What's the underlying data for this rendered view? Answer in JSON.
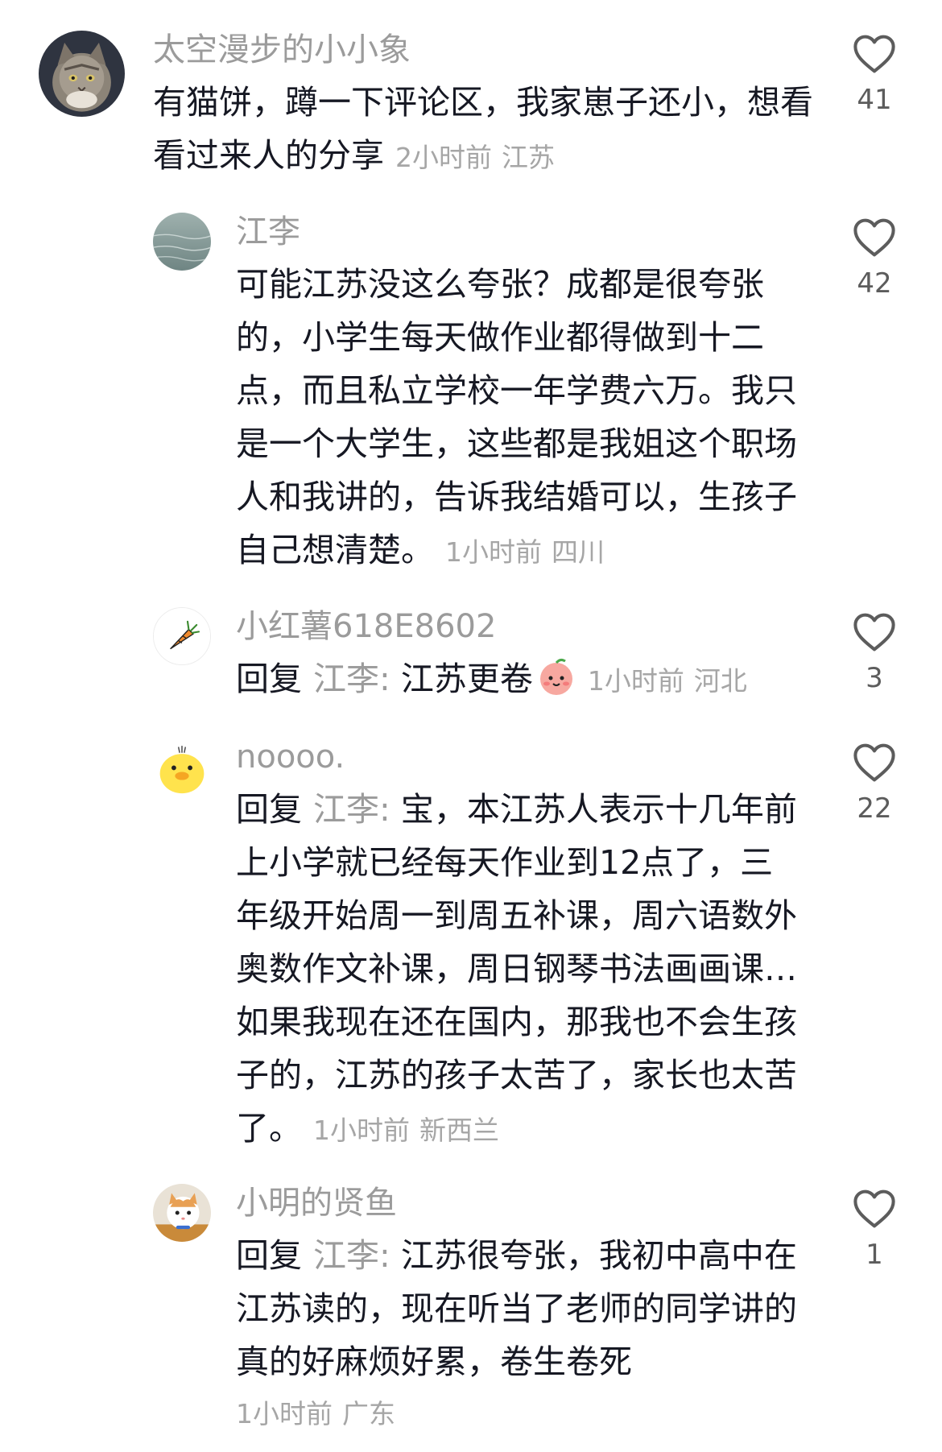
{
  "comments": [
    {
      "username": "太空漫步的小小象",
      "avatar_icon": "cat-avatar-icon",
      "text": "有猫饼，蹲一下评论区，我家崽子还小，想看看过来人的分享",
      "time": "2小时前",
      "location": "江苏",
      "likes": "41"
    },
    {
      "username": "江李",
      "avatar_icon": "sea-avatar-icon",
      "text": "可能江苏没这么夸张？成都是很夸张的，小学生每天做作业都得做到十二点，而且私立学校一年学费六万。我只是一个大学生，这些都是我姐这个职场人和我讲的，告诉我结婚可以，生孩子自己想清楚。",
      "time": "1小时前",
      "location": "四川",
      "likes": "42"
    },
    {
      "username": "小红薯618E8602",
      "avatar_icon": "carrot-avatar-icon",
      "reply_prefix": "回复",
      "reply_target": "江李:",
      "text": "江苏更卷",
      "emoji": "peach-face-emoji",
      "time": "1小时前",
      "location": "河北",
      "likes": "3"
    },
    {
      "username": "noooo.",
      "avatar_icon": "duck-avatar-icon",
      "reply_prefix": "回复",
      "reply_target": "江李:",
      "text": "宝，本江苏人表示十几年前上小学就已经每天作业到12点了，三年级开始周一到周五补课，周六语数外奥数作文补课，周日钢琴书法画画课…如果我现在还在国内，那我也不会生孩子的，江苏的孩子太苦了，家长也太苦了。",
      "time": "1小时前",
      "location": "新西兰",
      "likes": "22"
    },
    {
      "username": "小明的贤鱼",
      "avatar_icon": "kitten-avatar-icon",
      "reply_prefix": "回复",
      "reply_target": "江李:",
      "text": "江苏很夸张，我初中高中在江苏读的，现在听当了老师的同学讲的真的好麻烦好累，卷生卷死",
      "time": "1小时前",
      "location": "广东",
      "likes": "1"
    }
  ],
  "colors": {
    "username": "#9b9b9b",
    "text": "#161823",
    "meta": "#a6a6a6",
    "like_icon": "#5c5c5c"
  }
}
